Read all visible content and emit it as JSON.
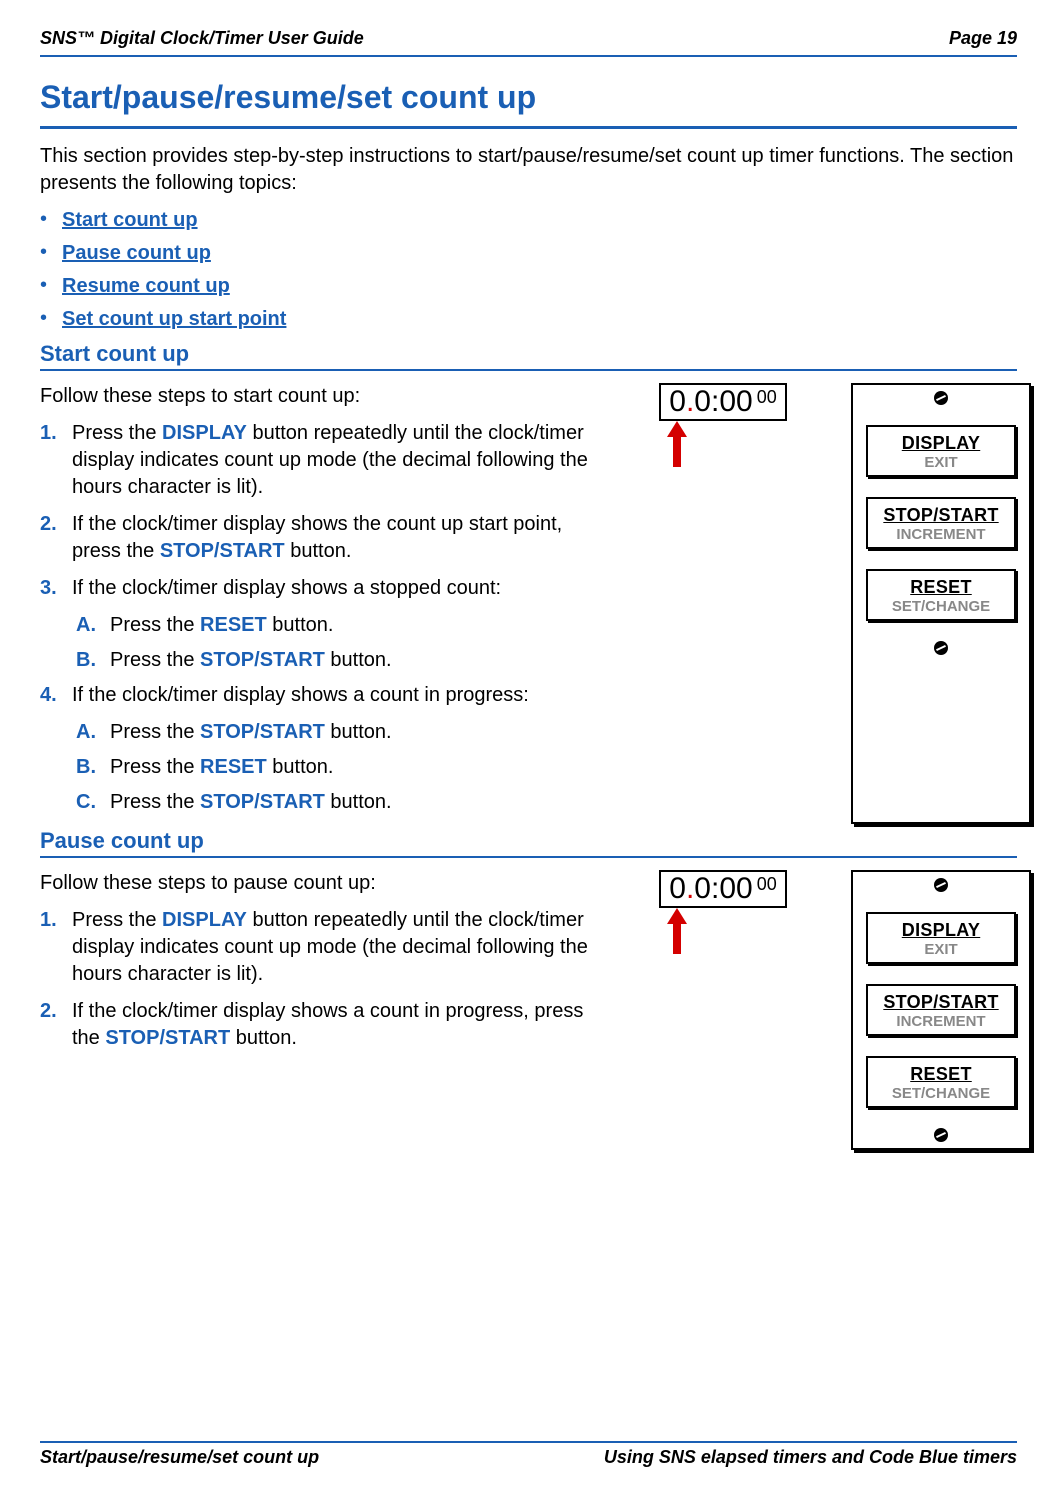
{
  "header": {
    "left": "SNS™ Digital Clock/Timer User Guide",
    "right": "Page 19"
  },
  "title": "Start/pause/resume/set count up",
  "intro": "This section provides step-by-step instructions to start/pause/resume/set count up timer functions. The section presents the following topics:",
  "toc": [
    "Start count up",
    "Pause count up",
    "Resume count up",
    "Set count up start point"
  ],
  "clock": {
    "h": "0",
    "dot": ".",
    "rest": "0:00",
    "sup": "00"
  },
  "panel": {
    "btn1_main": "DISPLAY",
    "btn1_sub": "EXIT",
    "btn2_main": "STOP/START",
    "btn2_sub": "INCREMENT",
    "btn3_main": "RESET",
    "btn3_sub": "SET/CHANGE"
  },
  "sec1": {
    "heading": "Start count up",
    "lead": "Follow these steps to start count up:",
    "s1_pre": "Press the ",
    "s1_kw": "DISPLAY",
    "s1_post": " button repeatedly until the clock/timer display indicates count up mode (the decimal following the hours character is lit).",
    "s2_pre": "If the clock/timer display shows the count up start point, press the ",
    "s2_kw": "STOP/START",
    "s2_post": " button.",
    "s3": "If the clock/timer display shows a stopped count:",
    "s3a_pre": "Press the ",
    "s3a_kw": "RESET",
    "s3a_post": " button.",
    "s3b_pre": "Press the ",
    "s3b_kw": "STOP/START",
    "s3b_post": " button.",
    "s4": "If the clock/timer display shows a count in progress:",
    "s4a_pre": "Press the ",
    "s4a_kw": "STOP/START",
    "s4a_post": " button.",
    "s4b_pre": "Press the ",
    "s4b_kw": "RESET",
    "s4b_post": " button.",
    "s4c_pre": "Press the ",
    "s4c_kw": "STOP/START",
    "s4c_post": " button."
  },
  "sec2": {
    "heading": "Pause count up",
    "lead": "Follow these steps to pause count up:",
    "s1_pre": "Press the ",
    "s1_kw": "DISPLAY",
    "s1_post": " button repeatedly until the clock/timer display indicates count up mode (the decimal following the hours character is lit).",
    "s2_pre": "If the clock/timer display shows a count in progress, press the ",
    "s2_kw": "STOP/START",
    "s2_post": " button."
  },
  "step_nums": {
    "n1": "1.",
    "n2": "2.",
    "n3": "3.",
    "n4": "4.",
    "A": "A.",
    "B": "B.",
    "C": "C."
  },
  "footer": {
    "left": "Start/pause/resume/set count up",
    "right": "Using SNS elapsed timers and Code Blue timers"
  }
}
